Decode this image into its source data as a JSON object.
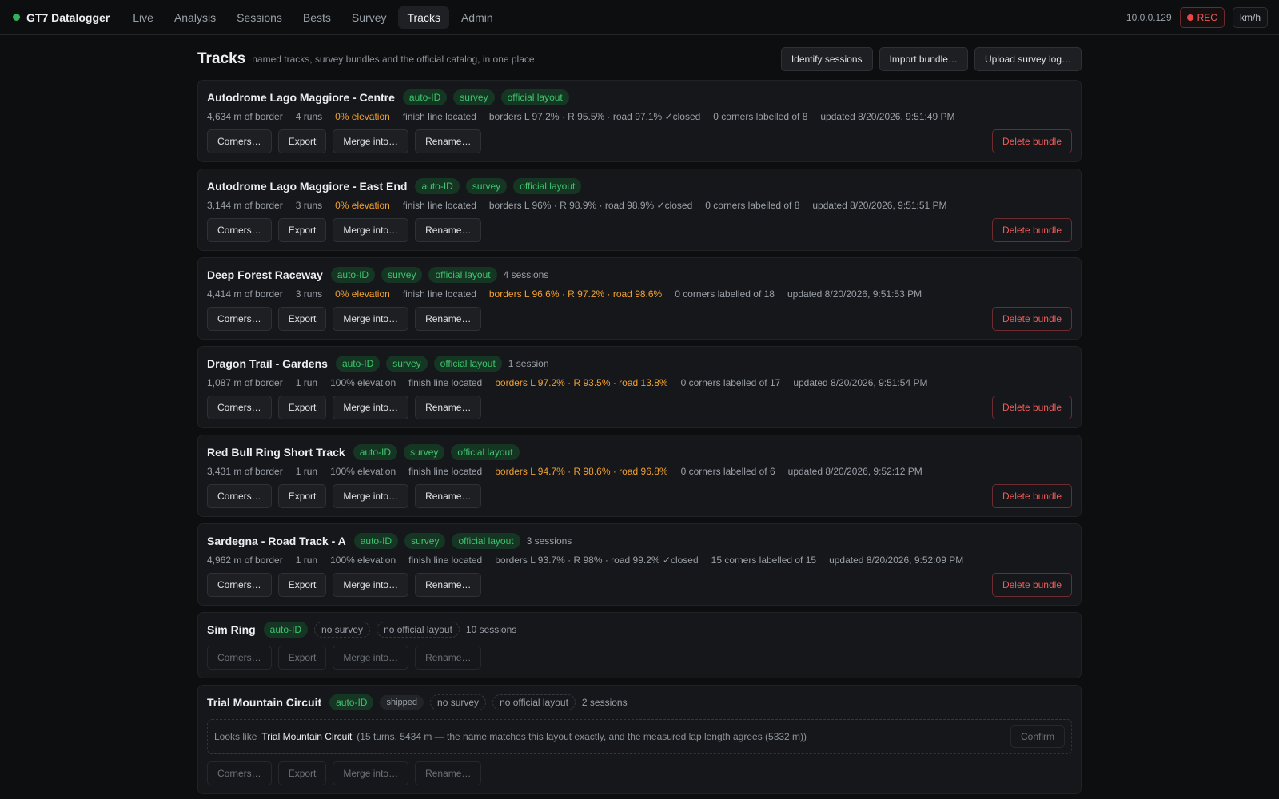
{
  "brand": {
    "name": "GT7 Datalogger",
    "status_color": "#2fb25a"
  },
  "nav": [
    {
      "label": "Live",
      "active": false
    },
    {
      "label": "Analysis",
      "active": false
    },
    {
      "label": "Sessions",
      "active": false
    },
    {
      "label": "Bests",
      "active": false
    },
    {
      "label": "Survey",
      "active": false
    },
    {
      "label": "Tracks",
      "active": true
    },
    {
      "label": "Admin",
      "active": false
    }
  ],
  "topright": {
    "ip": "10.0.0.129",
    "rec_label": "REC",
    "unit_label": "km/h"
  },
  "page": {
    "title": "Tracks",
    "subtitle": "named tracks, survey bundles and the official catalog, in one place",
    "identify_label": "Identify sessions",
    "import_label": "Import bundle…",
    "upload_label": "Upload survey log…"
  },
  "buttons": {
    "corners": "Corners…",
    "export": "Export",
    "merge": "Merge into…",
    "rename": "Rename…",
    "delete": "Delete bundle",
    "confirm": "Confirm"
  },
  "tracks": [
    {
      "name": "Autodrome Lago Maggiore - Centre",
      "tags": [
        "auto-ID",
        "survey",
        "official layout"
      ],
      "sessions": "",
      "border": "4,634 m of border",
      "runs": "4 runs",
      "elevation": "0% elevation",
      "elev_warn": true,
      "finish": "finish line located",
      "borders": "borders L 97.2% · R 95.5% · road 97.1% ✓closed",
      "borders_warn": false,
      "corners": "0 corners labelled of 8",
      "updated": "updated 8/20/2026, 9:51:49 PM"
    },
    {
      "name": "Autodrome Lago Maggiore - East End",
      "tags": [
        "auto-ID",
        "survey",
        "official layout"
      ],
      "sessions": "",
      "border": "3,144 m of border",
      "runs": "3 runs",
      "elevation": "0% elevation",
      "elev_warn": true,
      "finish": "finish line located",
      "borders": "borders L 96% · R 98.9% · road 98.9% ✓closed",
      "borders_warn": false,
      "corners": "0 corners labelled of 8",
      "updated": "updated 8/20/2026, 9:51:51 PM"
    },
    {
      "name": "Deep Forest Raceway",
      "tags": [
        "auto-ID",
        "survey",
        "official layout"
      ],
      "sessions": "4 sessions",
      "border": "4,414 m of border",
      "runs": "3 runs",
      "elevation": "0% elevation",
      "elev_warn": true,
      "finish": "finish line located",
      "borders": "borders L 96.6% · R 97.2% · road 98.6%",
      "borders_warn": true,
      "corners": "0 corners labelled of 18",
      "updated": "updated 8/20/2026, 9:51:53 PM"
    },
    {
      "name": "Dragon Trail - Gardens",
      "tags": [
        "auto-ID",
        "survey",
        "official layout"
      ],
      "sessions": "1 session",
      "border": "1,087 m of border",
      "runs": "1 run",
      "elevation": "100% elevation",
      "elev_warn": false,
      "finish": "finish line located",
      "borders": "borders L 97.2% · R 93.5% · road 13.8%",
      "borders_warn": true,
      "corners": "0 corners labelled of 17",
      "updated": "updated 8/20/2026, 9:51:54 PM"
    },
    {
      "name": "Red Bull Ring Short Track",
      "tags": [
        "auto-ID",
        "survey",
        "official layout"
      ],
      "sessions": "",
      "border": "3,431 m of border",
      "runs": "1 run",
      "elevation": "100% elevation",
      "elev_warn": false,
      "finish": "finish line located",
      "borders": "borders L 94.7% · R 98.6% · road 96.8%",
      "borders_warn": true,
      "corners": "0 corners labelled of 6",
      "updated": "updated 8/20/2026, 9:52:12 PM"
    },
    {
      "name": "Sardegna - Road Track - A",
      "tags": [
        "auto-ID",
        "survey",
        "official layout"
      ],
      "sessions": "3 sessions",
      "border": "4,962 m of border",
      "runs": "1 run",
      "elevation": "100% elevation",
      "elev_warn": false,
      "finish": "finish line located",
      "borders": "borders L 93.7% · R 98% · road 99.2% ✓closed",
      "borders_warn": false,
      "corners": "15 corners labelled of 15",
      "updated": "updated 8/20/2026, 9:52:09 PM"
    }
  ],
  "sim_ring": {
    "name": "Sim Ring",
    "tag_auto": "auto-ID",
    "tag_survey": "no survey",
    "tag_layout": "no official layout",
    "sessions": "10 sessions"
  },
  "trial": {
    "name": "Trial Mountain Circuit",
    "tag_auto": "auto-ID",
    "tag_shipped": "shipped",
    "tag_survey": "no survey",
    "tag_layout": "no official layout",
    "sessions": "2 sessions",
    "looks_like": "Looks like",
    "suggest_name": "Trial Mountain Circuit",
    "suggest_detail": "(15 turns, 5434 m — the name matches this layout exactly, and the measured lap length agrees (5332 m))"
  },
  "colors": {
    "accent_green": "#3ec46d",
    "warn_orange": "#f0a030",
    "danger_red": "#ef5a5a"
  }
}
